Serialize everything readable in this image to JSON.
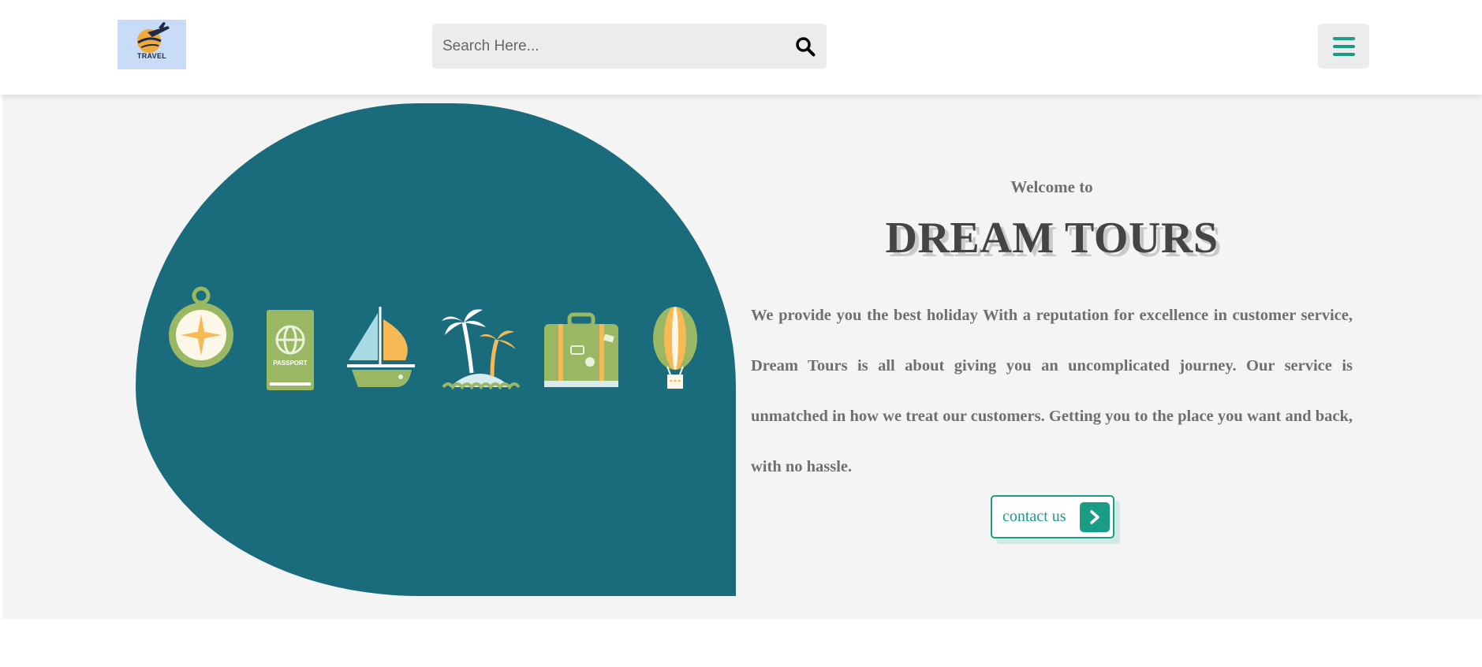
{
  "header": {
    "logo_text": "TRAVEL",
    "search": {
      "placeholder": "Search Here...",
      "value": ""
    },
    "search_icon": "search-icon",
    "menu_icon": "hamburger-icon"
  },
  "hero": {
    "icons": [
      "compass-icon",
      "passport-icon",
      "sailboat-icon",
      "island-icon",
      "suitcase-icon",
      "hot-air-balloon-icon"
    ],
    "passport_label": "PASSPORT",
    "welcome": "Welcome to",
    "title": "DREAM TOURS",
    "description": "We provide you the best holiday With a reputation for excellence in customer service, Dream Tours is all about giving you an uncomplicated journey. Our service is unmatched in how we treat our customers. Getting you to the place you want and back, with no hassle.",
    "contact_label": "contact us"
  },
  "colors": {
    "accent": "#1a9c87",
    "blob": "#1a6c7c",
    "hero_bg": "#f4f4f4",
    "icon_green": "#9ab763",
    "icon_orange": "#f7b955",
    "icon_light": "#d6ecee"
  }
}
